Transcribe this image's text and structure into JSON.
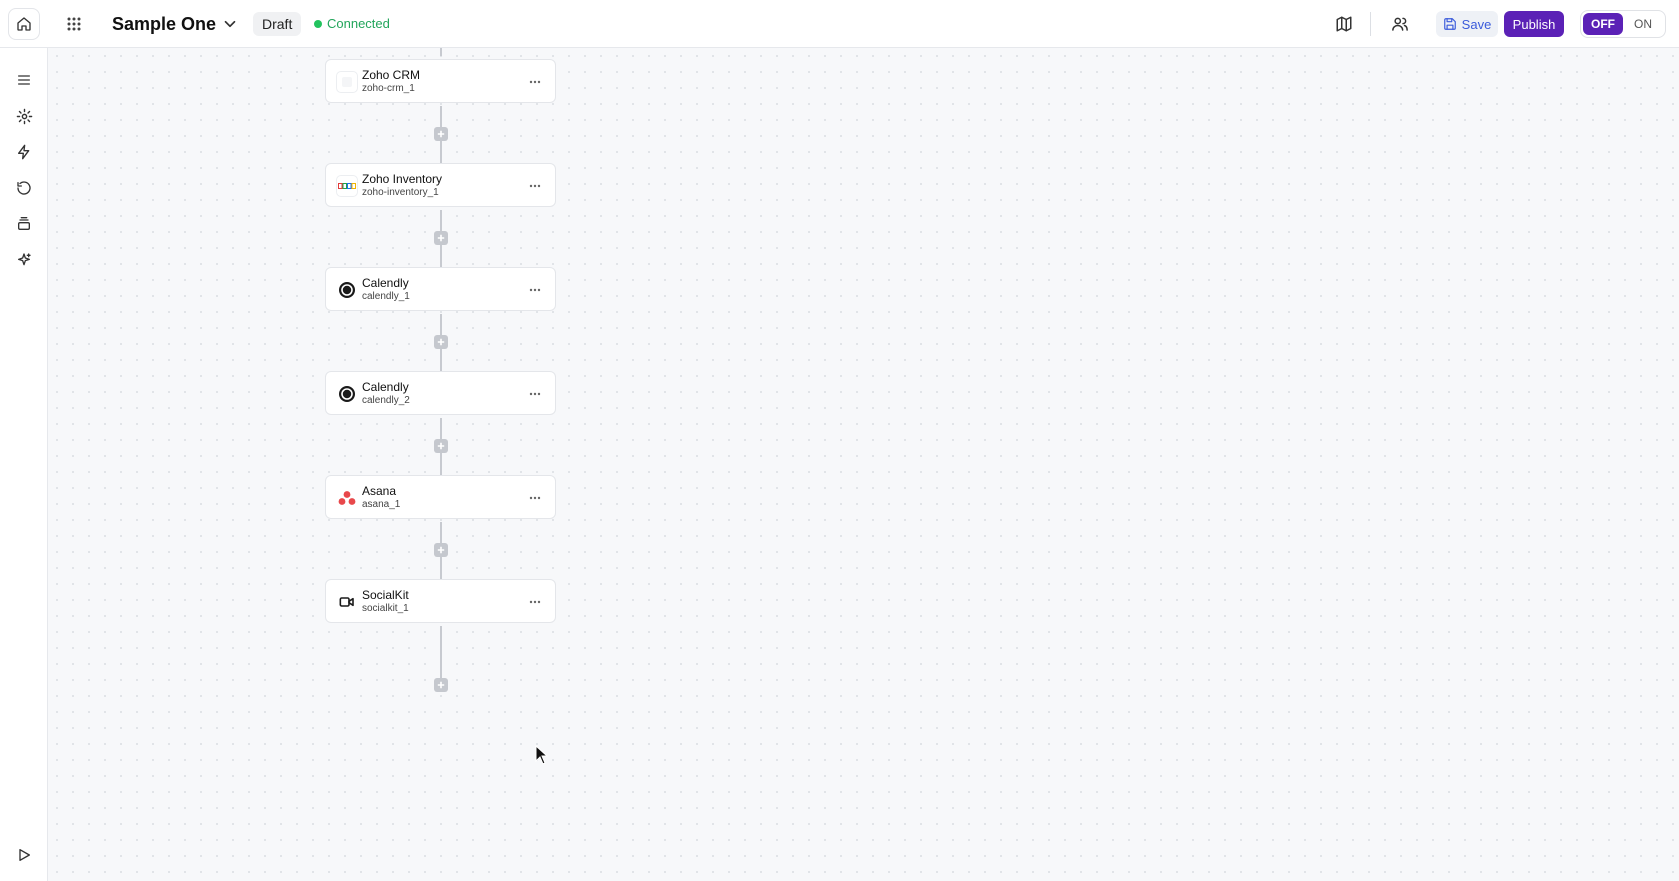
{
  "header": {
    "title": "Sample One",
    "draft_label": "Draft",
    "status_label": "Connected",
    "save_label": "Save",
    "publish_label": "Publish",
    "toggle_off_label": "OFF",
    "toggle_on_label": "ON"
  },
  "sidebar": {
    "items": [
      {
        "icon": "menu-icon"
      },
      {
        "icon": "settings-icon"
      },
      {
        "icon": "lightning-icon"
      },
      {
        "icon": "history-icon"
      },
      {
        "icon": "layers-icon"
      },
      {
        "icon": "sparkle-icon"
      },
      {
        "icon": "play-icon"
      }
    ]
  },
  "flow": {
    "nodes": [
      {
        "title": "Zoho CRM",
        "subtitle": "zoho-crm_1",
        "icon": "zoho-crm-icon"
      },
      {
        "title": "Zoho Inventory",
        "subtitle": "zoho-inventory_1",
        "icon": "zoho-inventory-icon"
      },
      {
        "title": "Calendly",
        "subtitle": "calendly_1",
        "icon": "calendly-icon"
      },
      {
        "title": "Calendly",
        "subtitle": "calendly_2",
        "icon": "calendly-icon"
      },
      {
        "title": "Asana",
        "subtitle": "asana_1",
        "icon": "asana-icon"
      },
      {
        "title": "SocialKit",
        "subtitle": "socialkit_1",
        "icon": "video-camera-icon"
      }
    ]
  },
  "colors": {
    "accent": "#5b21b6",
    "status_green": "#22c35e",
    "save_text": "#3b5bdb"
  }
}
